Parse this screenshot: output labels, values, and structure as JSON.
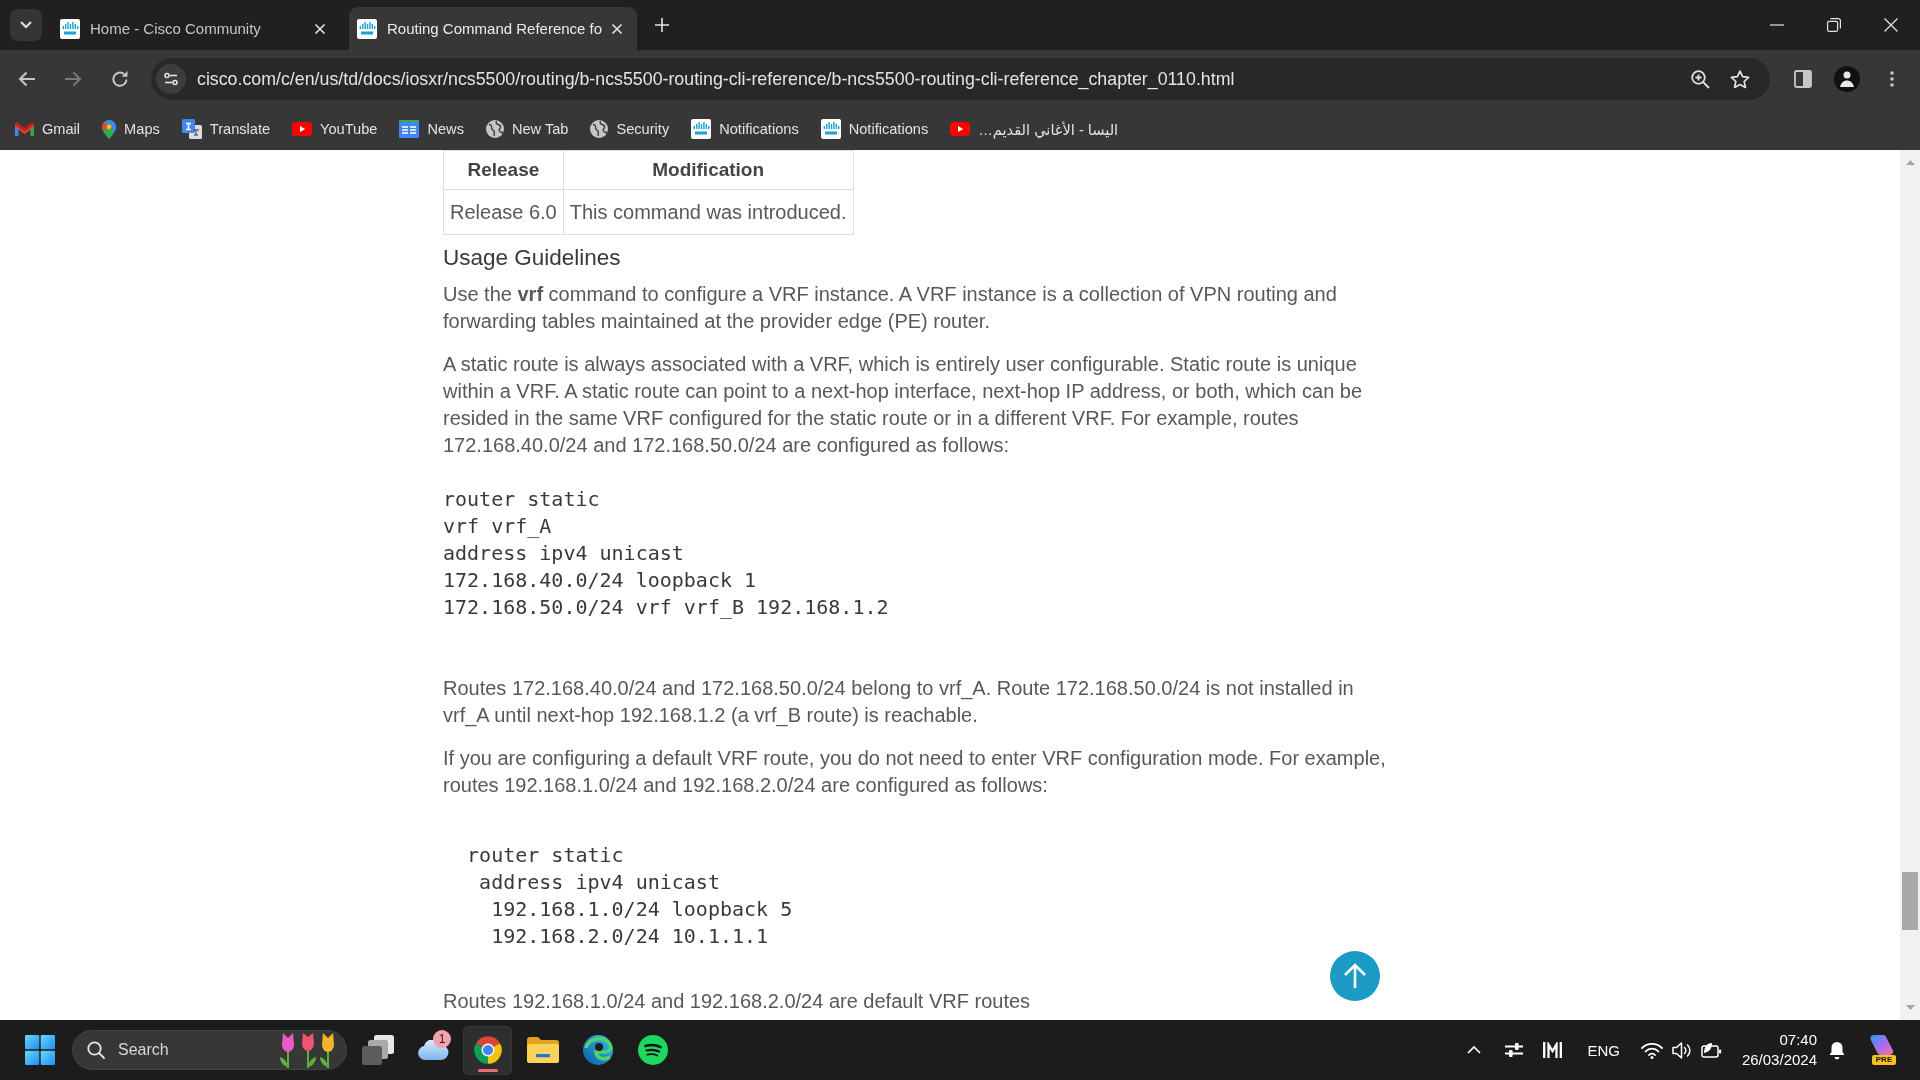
{
  "browser": {
    "tabs": [
      {
        "title": "Home - Cisco Community",
        "selected": false
      },
      {
        "title": "Routing Command Reference fo",
        "selected": true
      }
    ],
    "navigation": {
      "back_disabled": false,
      "forward_disabled": true
    },
    "address_bar": {
      "value": "cisco.com/c/en/us/td/docs/iosxr/ncs5500/routing/b-ncs5500-routing-cli-reference/b-ncs5500-routing-cli-reference_chapter_0110.html"
    },
    "bookmarks": [
      {
        "label": "Gmail",
        "kind": "mail"
      },
      {
        "label": "Maps",
        "kind": "map"
      },
      {
        "label": "Translate",
        "kind": "translate"
      },
      {
        "label": "YouTube",
        "kind": "video"
      },
      {
        "label": "News",
        "kind": "news"
      },
      {
        "label": "New Tab",
        "kind": "globe"
      },
      {
        "label": "Security",
        "kind": "globe"
      },
      {
        "label": "Notifications",
        "kind": "site"
      },
      {
        "label": "Notifications",
        "kind": "site"
      },
      {
        "label": "اليسا - الأغاني القديم…",
        "kind": "video"
      }
    ]
  },
  "page": {
    "history_table": {
      "columns": [
        "Release",
        "Modification"
      ],
      "rows": [
        [
          "Release 6.0",
          "This command was introduced."
        ]
      ]
    },
    "heading": "Usage Guidelines",
    "blocks": [
      {
        "kind": "paragraph",
        "text": "Use the **vrf** command to configure a VRF instance. A VRF instance is a collection of VPN routing and forwarding tables maintained at the provider edge (PE) router."
      },
      {
        "kind": "paragraph",
        "text": "A static route is always associated with a VRF, which is entirely user configurable. Static route is unique within a VRF. A static route can point to a next-hop interface, next-hop IP address, or both, which can be resided in the same VRF configured for the static route or in a different VRF. For example, routes 172.168.40.0/24 and 172.168.50.0/24 are configured as follows:"
      },
      {
        "kind": "code",
        "lines": [
          "router static",
          "vrf vrf_A",
          "address ipv4 unicast",
          "172.168.40.0/24 loopback 1",
          "172.168.50.0/24 vrf vrf_B 192.168.1.2"
        ]
      },
      {
        "kind": "paragraph",
        "text": "Routes 172.168.40.0/24 and 172.168.50.0/24 belong to vrf_A. Route 172.168.50.0/24 is not installed in vrf_A until next-hop 192.168.1.2 (a vrf_B route) is reachable."
      },
      {
        "kind": "paragraph",
        "text": "If you are configuring a default VRF route, you do not need to enter VRF configuration mode. For example, routes 192.168.1.0/24 and 192.168.2.0/24 are configured as follows:"
      },
      {
        "kind": "code",
        "lines": [
          "  router static",
          "   address ipv4 unicast",
          "    192.168.1.0/24 loopback 5",
          "    192.168.2.0/24 10.1.1.1"
        ]
      },
      {
        "kind": "paragraph",
        "text": "Routes 192.168.1.0/24 and 192.168.2.0/24 are default VRF routes"
      }
    ]
  },
  "taskbar": {
    "search": {
      "placeholder": "Search"
    },
    "apps": [
      {
        "kind": "task_view",
        "active": false
      },
      {
        "kind": "widgets",
        "active": false,
        "badge": "1"
      },
      {
        "kind": "browser",
        "active": true
      },
      {
        "kind": "files",
        "active": false
      },
      {
        "kind": "edge",
        "active": false
      },
      {
        "kind": "music",
        "active": false
      }
    ],
    "tray": {
      "language": "ENG",
      "time": "07:40",
      "date": "26/03/2024",
      "assistant_tag": "PRE"
    }
  }
}
